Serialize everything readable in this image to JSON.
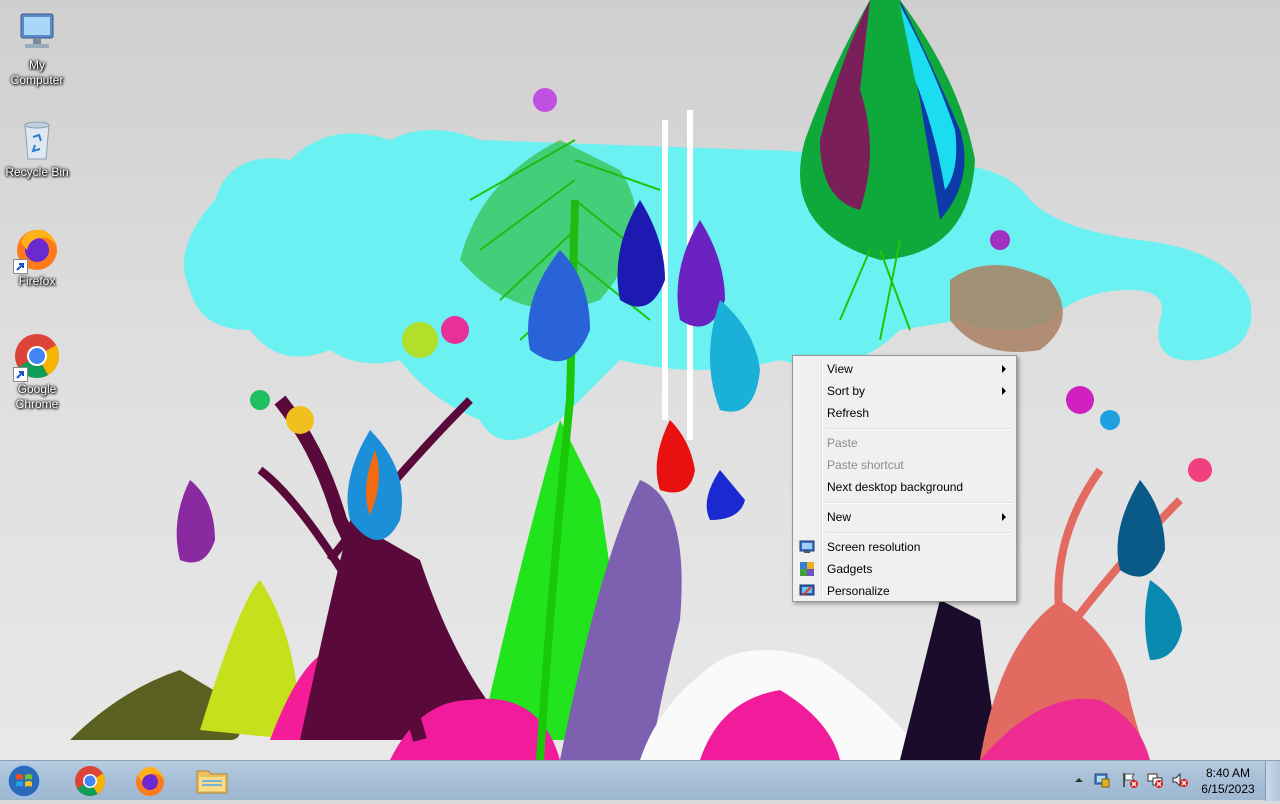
{
  "desktop": {
    "icons": [
      {
        "label_line1": "My",
        "label_line2": "Computer",
        "icon": "computer-icon"
      },
      {
        "label": "Recycle Bin",
        "icon": "recycle-bin-icon"
      },
      {
        "label": "Firefox",
        "icon": "firefox-icon",
        "shortcut": true
      },
      {
        "label_line1": "Google",
        "label_line2": "Chrome",
        "icon": "chrome-icon",
        "shortcut": true
      }
    ]
  },
  "context_menu": {
    "items": [
      {
        "label": "View",
        "submenu": true,
        "enabled": true
      },
      {
        "label": "Sort by",
        "submenu": true,
        "enabled": true
      },
      {
        "label": "Refresh",
        "enabled": true
      },
      {
        "label": "Paste",
        "enabled": false
      },
      {
        "label": "Paste shortcut",
        "enabled": false
      },
      {
        "label": "Next desktop background",
        "enabled": true
      },
      {
        "label": "New",
        "submenu": true,
        "enabled": true
      },
      {
        "label": "Screen resolution",
        "icon": "screen-resolution-icon",
        "enabled": true
      },
      {
        "label": "Gadgets",
        "icon": "gadgets-icon",
        "enabled": true
      },
      {
        "label": "Personalize",
        "icon": "personalize-icon",
        "enabled": true
      }
    ]
  },
  "taskbar": {
    "start_icon": "windows-start-icon",
    "pinned": [
      "chrome-icon",
      "firefox-icon",
      "file-explorer-icon"
    ],
    "tray_icons": [
      "show-hidden-icons-arrow",
      "action-center-icon",
      "flag-error-icon",
      "network-error-icon",
      "volume-muted-icon"
    ],
    "clock": {
      "time": "8:40 AM",
      "date": "6/15/2023"
    }
  },
  "colors": {
    "taskbar": "#a9c0d8",
    "menu_bg": "#f0f0f0",
    "disabled_text": "#8d8d8d"
  }
}
